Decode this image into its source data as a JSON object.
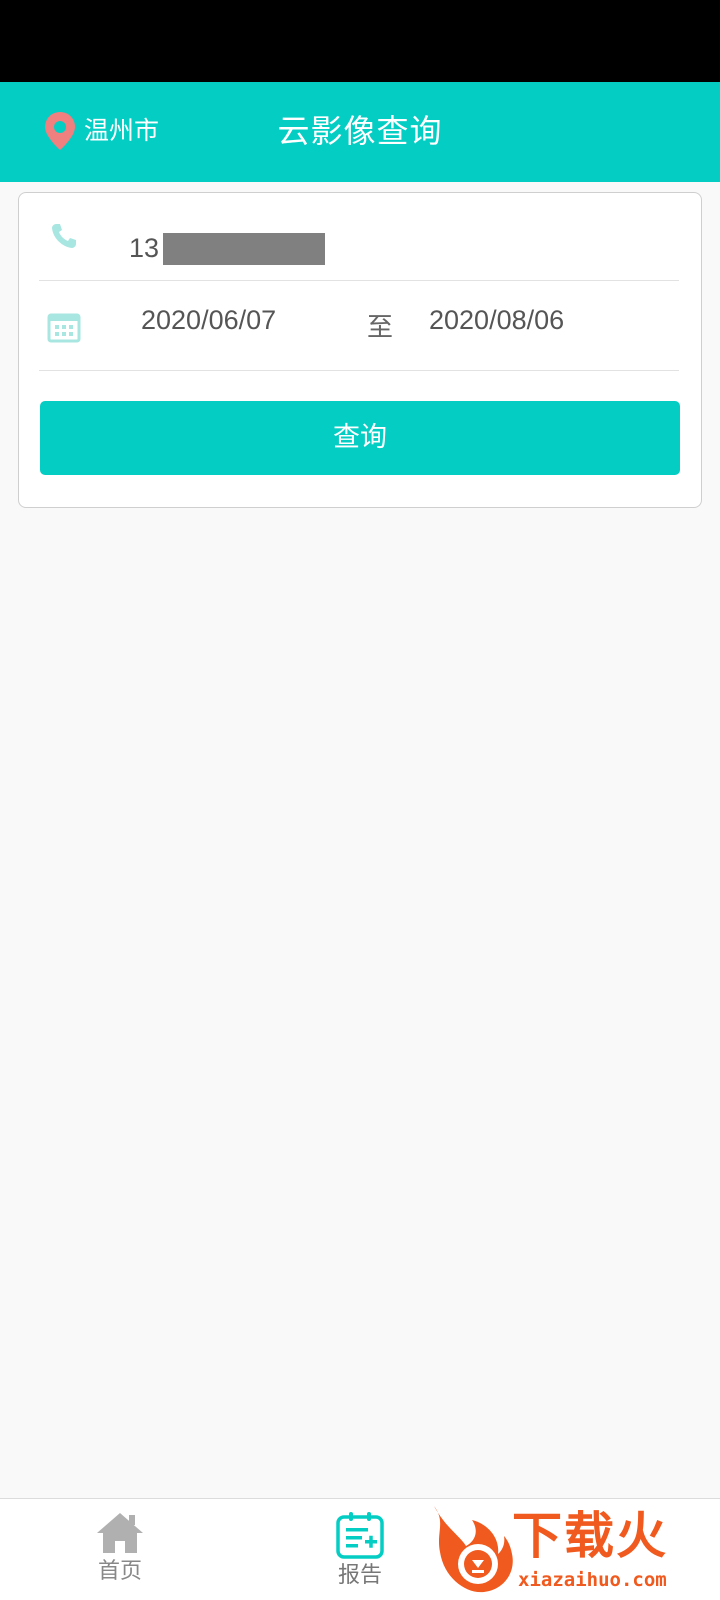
{
  "header": {
    "location": "温州市",
    "title": "云影像查询"
  },
  "form": {
    "phone_value": "13",
    "date_from": "2020/06/07",
    "date_separator": "至",
    "date_to": "2020/08/06",
    "query_button_label": "查询"
  },
  "tab_bar": {
    "items": [
      {
        "label": "首页",
        "icon": "home-icon"
      },
      {
        "label": "报告",
        "icon": "report-icon"
      }
    ]
  },
  "watermark": {
    "brand": "下载火",
    "url": "xiazaihuo.com"
  },
  "colors": {
    "accent": "#04cdc4",
    "pin": "#f07f7f",
    "brand_orange": "#f05a1e"
  }
}
